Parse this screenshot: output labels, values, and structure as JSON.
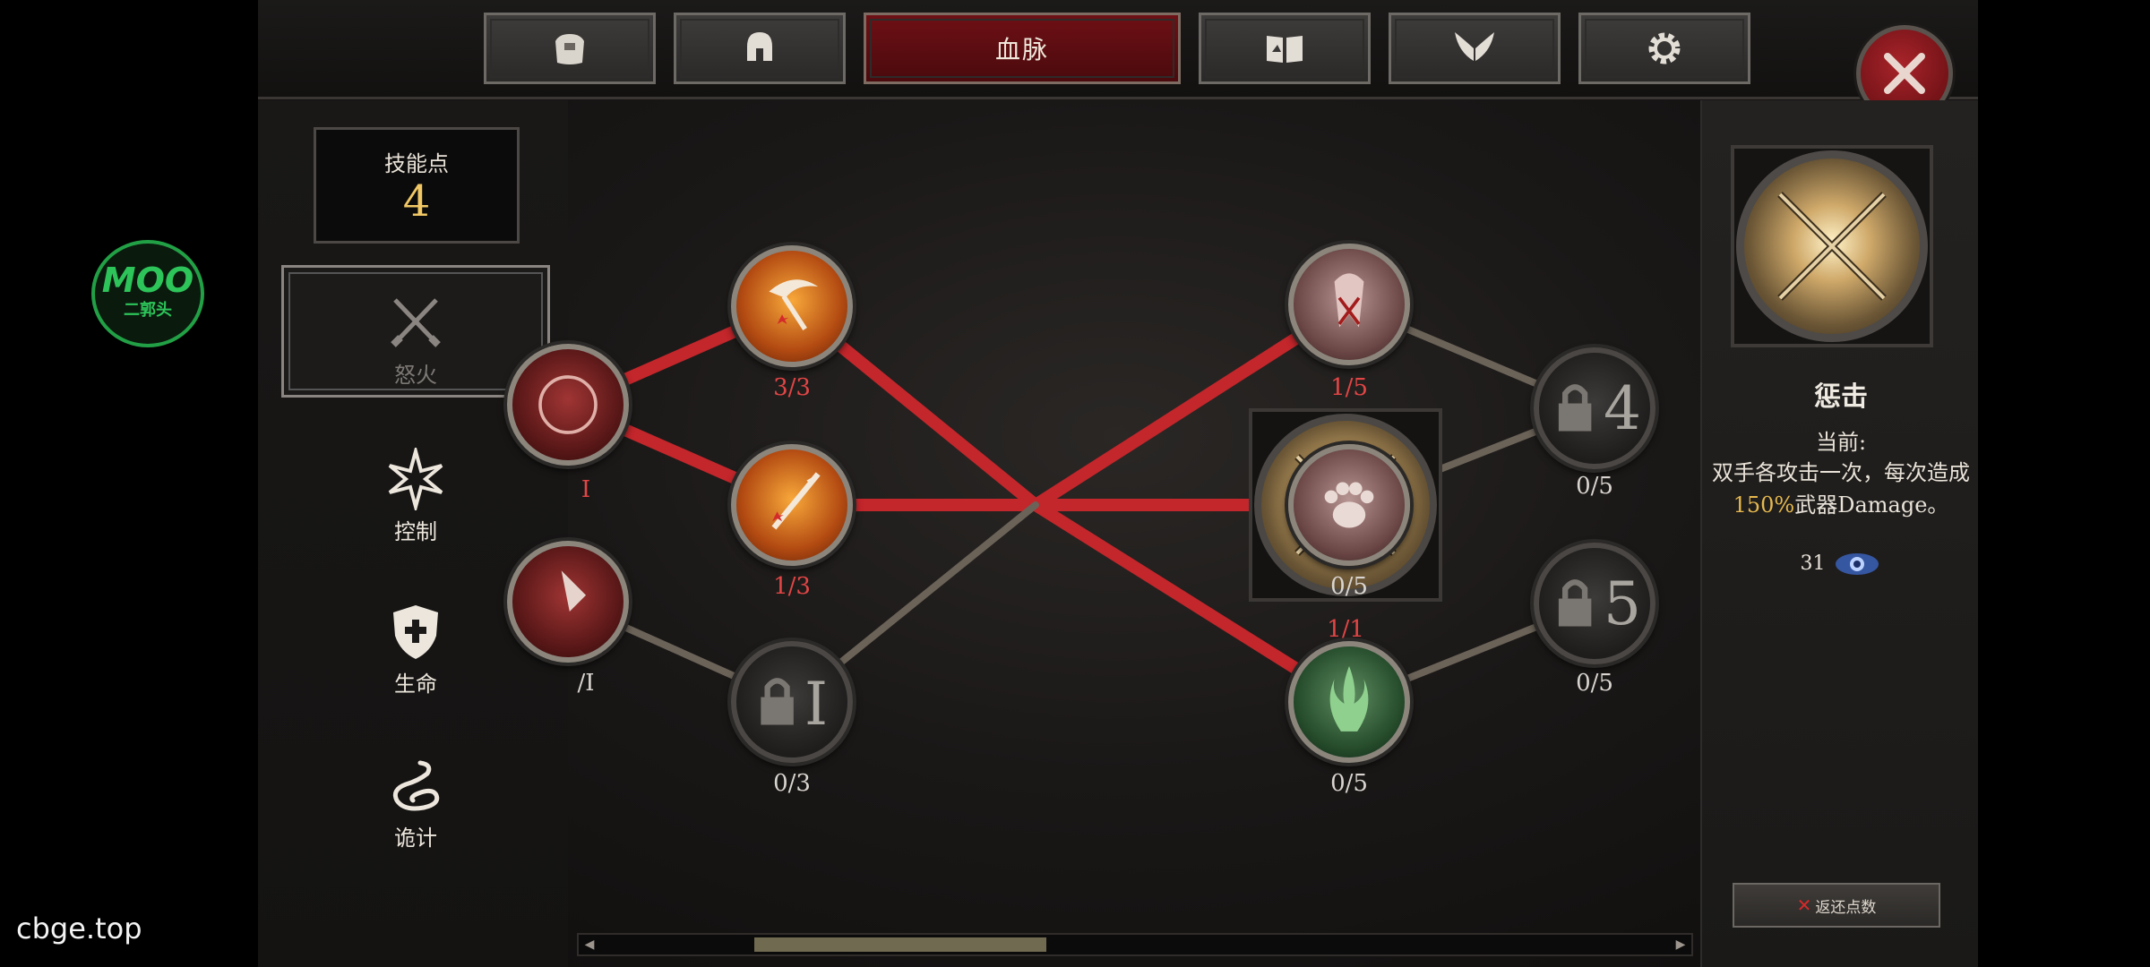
{
  "tabs": [
    {
      "icon": "bag-icon"
    },
    {
      "icon": "helmet-icon"
    },
    {
      "label": "血脉",
      "active": true
    },
    {
      "icon": "book-icon"
    },
    {
      "icon": "wings-icon"
    },
    {
      "icon": "gear-icon"
    }
  ],
  "skill_points": {
    "label": "技能点",
    "value": "4"
  },
  "categories": [
    {
      "label": "怒火",
      "icon": "crossed-swords-icon",
      "selected": true
    },
    {
      "label": "控制",
      "icon": "starburst-icon"
    },
    {
      "label": "生命",
      "icon": "shield-cross-icon"
    },
    {
      "label": "诡计",
      "icon": "snake-icon"
    }
  ],
  "tree": {
    "nodes": [
      {
        "id": "partial-top",
        "label": "I"
      },
      {
        "id": "partial-bottom",
        "label": "/I"
      },
      {
        "id": "scythe",
        "label": "3/3"
      },
      {
        "id": "spear",
        "label": "1/3"
      },
      {
        "id": "locked-1",
        "label": "0/3",
        "lock_number": "I"
      },
      {
        "id": "crossed-swords",
        "label": "1/1"
      },
      {
        "id": "blood-claw",
        "label": "1/5"
      },
      {
        "id": "paw",
        "label": "0/5"
      },
      {
        "id": "green-spirit",
        "label": "0/5"
      },
      {
        "id": "locked-4",
        "label": "0/5",
        "lock_number": "4"
      },
      {
        "id": "locked-5",
        "label": "0/5",
        "lock_number": "5"
      }
    ],
    "scroll_position": 0.2
  },
  "detail": {
    "name": "惩击",
    "current_label": "当前:",
    "desc_pre": "双手各攻击一次，每次造成",
    "desc_highlight": "150%",
    "desc_post": "武器Damage。",
    "cost": "31",
    "cost_icon": "eye-orb-icon",
    "refund_label": "返还点数"
  },
  "overlays": {
    "logo_title": "MOO",
    "logo_sub": "二郭头",
    "watermark": "cbge.top"
  },
  "colors": {
    "active_path": "#c3262b",
    "inactive_path": "#6b6358",
    "accent_gold": "#f1c865",
    "red_label": "#e24545"
  }
}
